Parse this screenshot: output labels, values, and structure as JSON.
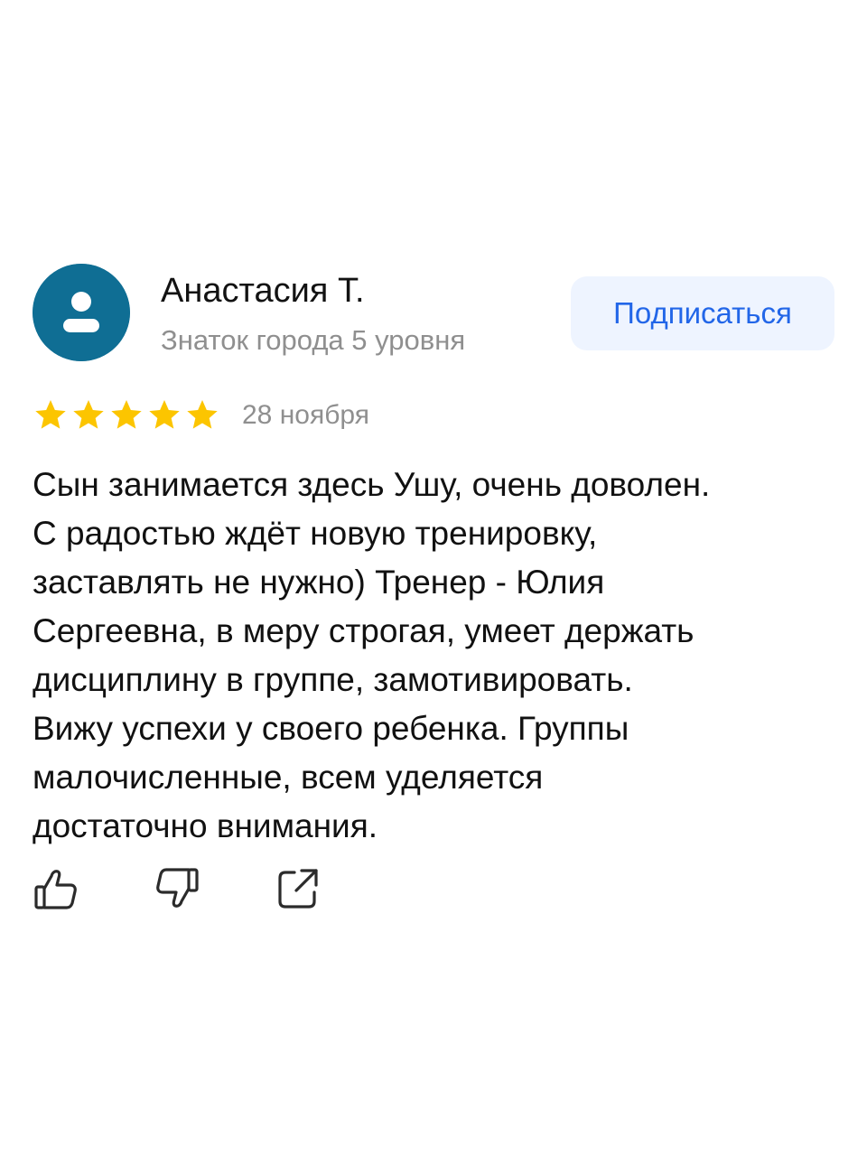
{
  "review": {
    "author": {
      "name": "Анастасия Т.",
      "level": "Знаток города 5 уровня",
      "avatar_color": "#0f6e94"
    },
    "subscribe_label": "Подписаться",
    "rating": {
      "stars": 5,
      "max": 5,
      "star_color": "#fcc500"
    },
    "date": "28 ноября",
    "text_lines": [
      "Сын занимается здесь Ушу, очень доволен.",
      "С радостью ждёт новую тренировку,",
      "заставлять не нужно) Тренер - Юлия",
      "Сергеевна, в меру строгая, умеет держать",
      "дисциплину в группе, замотивировать.",
      "Вижу успехи у своего ребенка. Группы",
      "малочисленные, всем уделяется",
      "достаточно внимания."
    ],
    "actions": {
      "like_icon": "thumbs-up-icon",
      "dislike_icon": "thumbs-down-icon",
      "share_icon": "share-icon"
    }
  },
  "colors": {
    "accent": "#2266e8",
    "subscribe_bg": "#eef4ff",
    "muted_text": "#8f8f8f"
  }
}
